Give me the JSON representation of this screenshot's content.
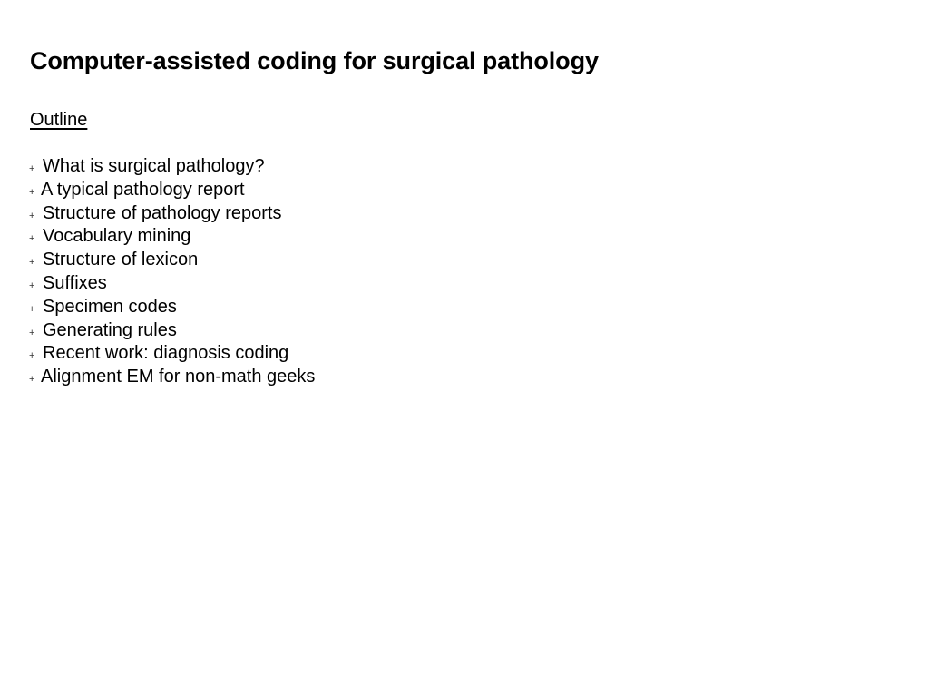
{
  "slide": {
    "title": "Computer-assisted coding for surgical pathology",
    "section_heading": "Outline",
    "bullet_icon": "plus-bullet",
    "outline_items": [
      {
        "label": "What is surgical pathology?"
      },
      {
        "label": "A typical pathology report"
      },
      {
        "label": "Structure of pathology reports"
      },
      {
        "label": "Vocabulary mining"
      },
      {
        "label": "Structure of lexicon"
      },
      {
        "label": "Suffixes"
      },
      {
        "label": "Specimen codes"
      },
      {
        "label": "Generating rules"
      },
      {
        "label": "Recent work: diagnosis coding"
      },
      {
        "label": "Alignment EM for non-math geeks"
      }
    ]
  }
}
